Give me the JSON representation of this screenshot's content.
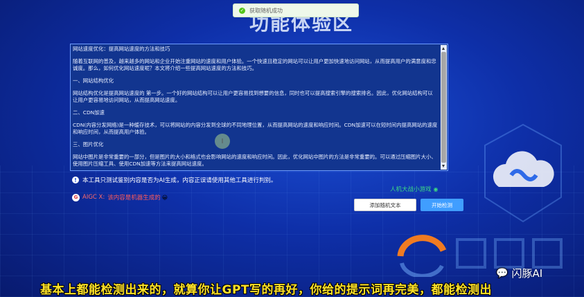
{
  "toast": {
    "message": "获取随机成功"
  },
  "page_title": "功能体验区",
  "text_panel": {
    "paragraphs": [
      "网站速度优化：提高网站速度的方法和技巧",
      "随着互联网的普及，越来越多的网站和企业开始注重网站的速度和用户体验。一个快速且稳定的网站可以让用户更加快速地访问网站，从而提高用户的满意度和忠诚度。那么，如何优化网站速度呢？本文将介绍一些提高网站速度的方法和技巧。",
      "一、网站结构优化",
      "网站结构优化是提高网站速度的 第一步。一个好的网站结构可以让用户更容易找到想要的信息，同时也可以提高搜索引擎的搜索排名。因此，优化网站结构可以让用户更容易地访问网站，从而提高网站速度。",
      "二、CDN加速",
      "CDN(内容分发网络)是一种缓存技术，可以将网站的内容分发到全球的不同地理位置，从而提高网站的速度和响应时间。CDN加速可以在短时间内提高网站的速度和响应时间，从而提高用户体验。",
      "三、图片优化",
      "网站中图片是非常重要的一部分，但是图片的大小和格式也会影响网站的速度和响应时间。因此，优化网站中图片的方法是非常重要的。可以通过压缩图片大小、使用图片压缩工具、使用CDN加速等方法来提高网站速度。"
    ]
  },
  "notice": {
    "text": "本工具只测试鉴别内容是否为AI生成，内容正误请使用其他工具进行判别。"
  },
  "game_link": {
    "text": "人机大战小游戏"
  },
  "aigc": {
    "label": "AIGC X:",
    "result": "该内容是机器生成的"
  },
  "buttons": {
    "add_random": "添加随机文本",
    "start": "开始检测"
  },
  "subtitle": "基本上都能检测出来的，就算你让GPT写的再好，你给的提示词再完美，都能检测出",
  "watermark": {
    "text": "闪豚AI"
  },
  "colors": {
    "accent": "#409eff",
    "background": "#0e2fa8",
    "subtitle": "#ffe227",
    "aigc_result": "#ff5a5a",
    "game_link": "#3ddc84"
  }
}
